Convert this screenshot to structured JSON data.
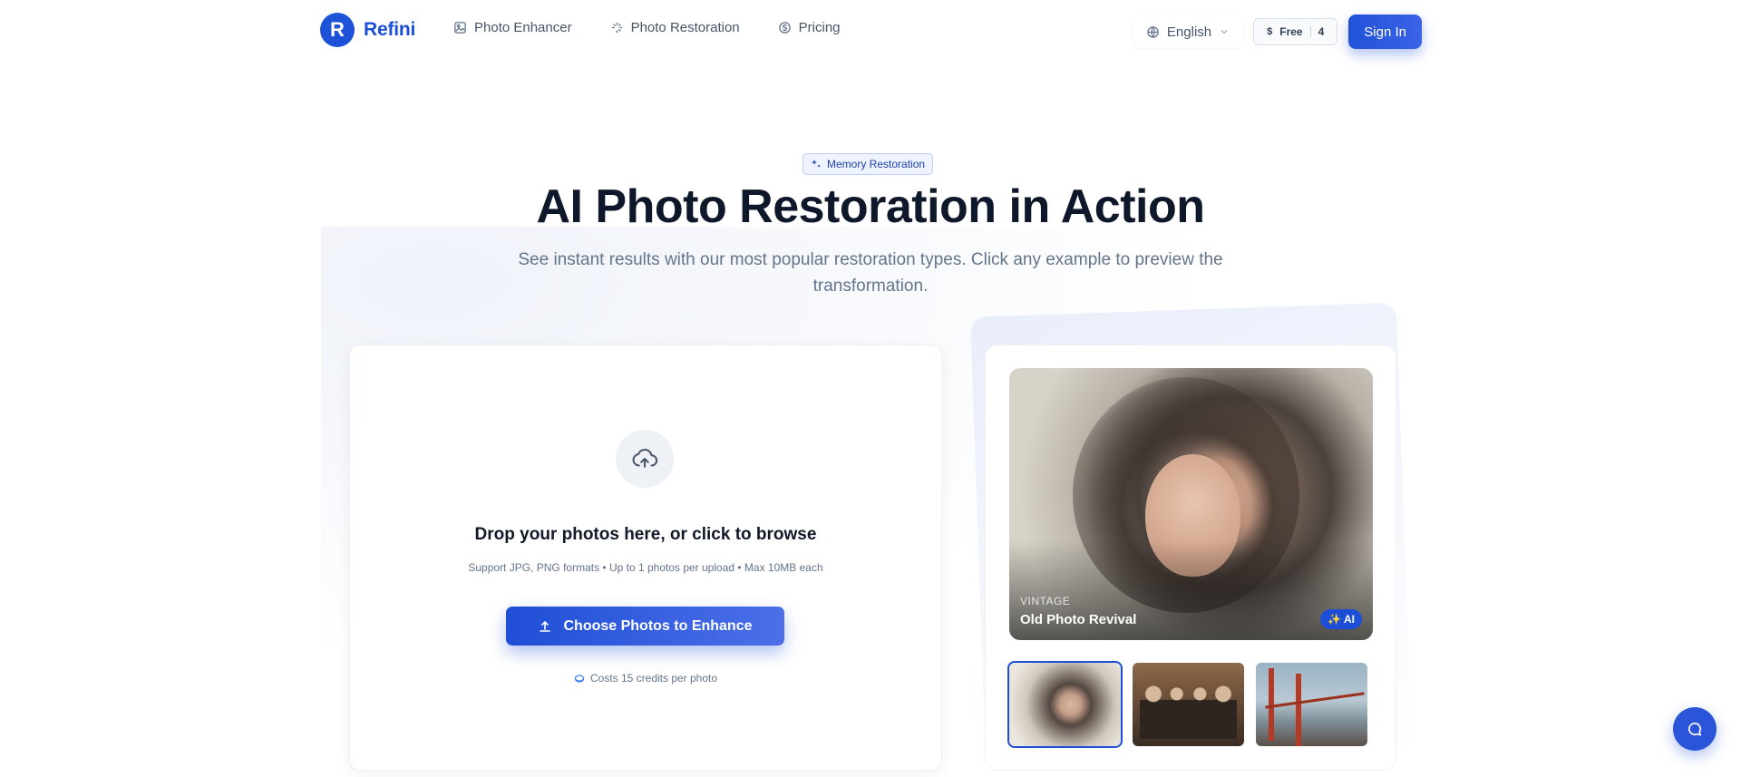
{
  "header": {
    "brand": "Refini",
    "brand_initial": "R",
    "nav": [
      {
        "label": "Photo Enhancer",
        "icon": "image-icon"
      },
      {
        "label": "Photo Restoration",
        "icon": "sparkle-wand-icon"
      },
      {
        "label": "Pricing",
        "icon": "dollar-circle-icon"
      }
    ],
    "language": "English",
    "credits": {
      "plan": "Free",
      "count": "4",
      "icon": "dollar-icon"
    },
    "signin_label": "Sign In"
  },
  "hero": {
    "badge": "Memory Restoration",
    "title": "AI Photo Restoration in Action",
    "subtitle": "See instant results with our most popular restoration types. Click any example to preview the transformation."
  },
  "upload": {
    "title": "Drop your photos here, or click to browse",
    "subtitle": "Support JPG, PNG formats • Up to 1 photos per upload • Max 10MB each",
    "button_label": "Choose Photos to Enhance",
    "cost_note": "Costs 15 credits per photo"
  },
  "preview": {
    "tag": "VINTAGE",
    "caption": "Old Photo Revival",
    "ai_badge": "✨ AI",
    "thumbnails": [
      {
        "name": "vintage-portrait",
        "active": true
      },
      {
        "name": "family-group",
        "active": false
      },
      {
        "name": "bridge-workers",
        "active": false
      }
    ]
  },
  "colors": {
    "accent": "#1d4ed8",
    "text_primary": "#0f172a",
    "text_muted": "#64748b"
  }
}
